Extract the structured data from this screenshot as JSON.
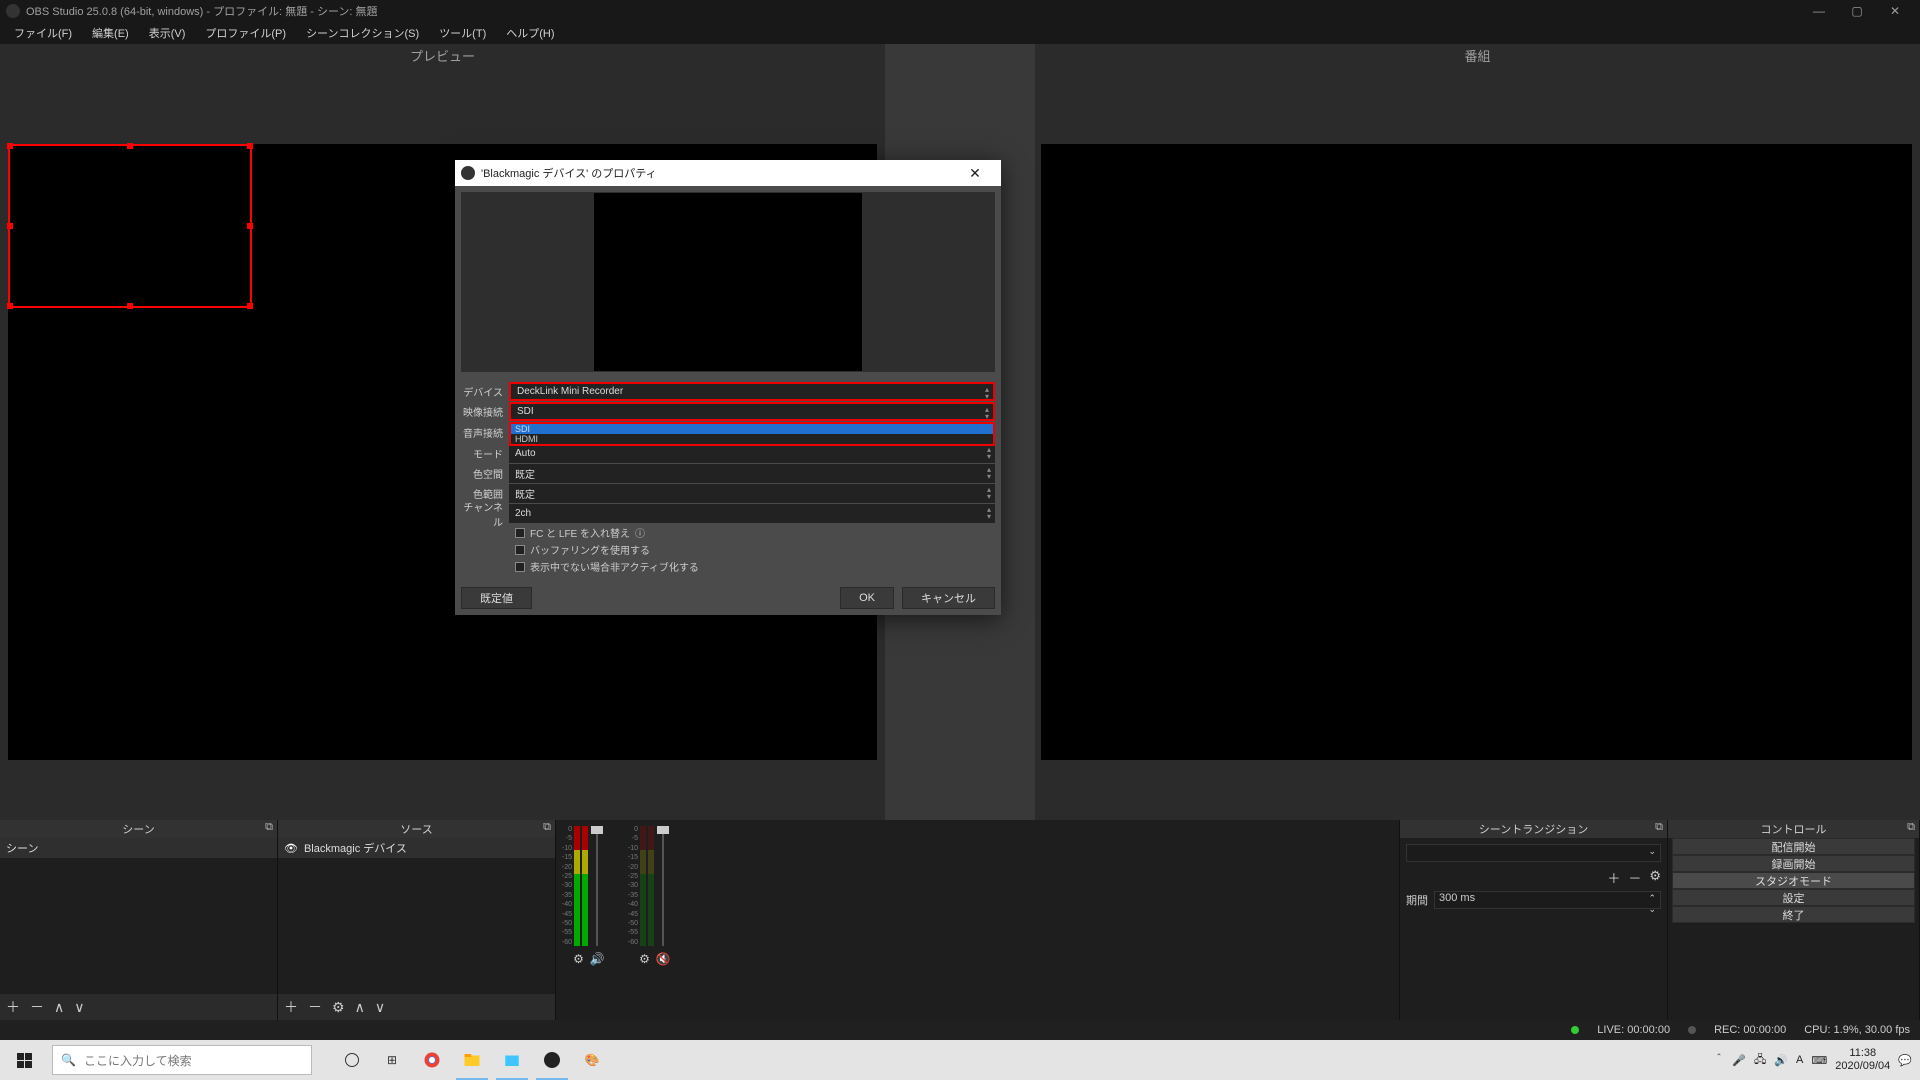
{
  "title": "OBS Studio 25.0.8 (64-bit, windows) - プロファイル: 無題 - シーン: 無題",
  "menu": {
    "file": "ファイル(F)",
    "edit": "編集(E)",
    "view": "表示(V)",
    "profile": "プロファイル(P)",
    "scenecol": "シーンコレクション(S)",
    "tools": "ツール(T)",
    "help": "ヘルプ(H)"
  },
  "preview": {
    "left": "プレビュー",
    "right": "番組"
  },
  "docks": {
    "scenes": {
      "title": "シーン",
      "item": "シーン"
    },
    "sources": {
      "title": "ソース",
      "item": "Blackmagic デバイス"
    },
    "transitions": {
      "title": "シーントランジション",
      "duration_label": "期間",
      "duration": "300 ms"
    },
    "controls": {
      "title": "コントロール",
      "start_stream": "配信開始",
      "start_record": "録画開始",
      "studio": "スタジオモード",
      "settings": "設定",
      "exit": "終了"
    }
  },
  "meter_ticks": [
    "0",
    "-5",
    "-10",
    "-15",
    "-20",
    "-25",
    "-30",
    "-35",
    "-40",
    "-45",
    "-50",
    "-55",
    "-60"
  ],
  "status": {
    "live": "LIVE: 00:00:00",
    "rec": "REC: 00:00:00",
    "cpu": "CPU: 1.9%, 30.00 fps"
  },
  "dialog": {
    "title": "'Blackmagic デバイス' のプロパティ",
    "labels": {
      "device": "デバイス",
      "video": "映像接続",
      "audio": "音声接続",
      "mode": "モード",
      "colorspace": "色空間",
      "colorrange": "色範囲",
      "channel": "チャンネル"
    },
    "values": {
      "device": "DeckLink Mini Recorder",
      "video": "SDI",
      "mode": "Auto",
      "colorspace": "既定",
      "colorrange": "既定",
      "channel": "2ch"
    },
    "dd": {
      "opt1": "SDI",
      "opt2": "HDMI"
    },
    "checks": {
      "swap": "FC と LFE を入れ替え",
      "buffer": "バッファリングを使用する",
      "deactivate": "表示中でない場合非アクティブ化する"
    },
    "buttons": {
      "defaults": "既定値",
      "ok": "OK",
      "cancel": "キャンセル"
    }
  },
  "taskbar": {
    "search_placeholder": "ここに入力して検索",
    "time": "11:38",
    "date": "2020/09/04",
    "ime": "A"
  }
}
